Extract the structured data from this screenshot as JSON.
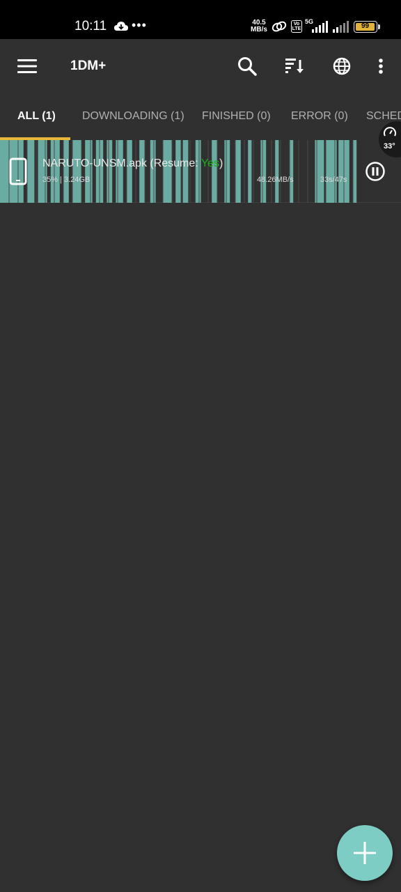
{
  "status_bar": {
    "time": "10:11",
    "net_speed_value": "40.5",
    "net_speed_unit": "MB/s",
    "volte_label": "Vo LTE",
    "network_type": "5G",
    "battery": "99"
  },
  "app_bar": {
    "title": "1DM+",
    "icons": [
      "menu-icon",
      "search-icon",
      "sort-icon",
      "globe-icon",
      "more-vert-icon"
    ]
  },
  "tabs": [
    {
      "label": "ALL (1)",
      "active": true
    },
    {
      "label": "DOWNLOADING (1)",
      "active": false
    },
    {
      "label": "FINISHED (0)",
      "active": false
    },
    {
      "label": "ERROR (0)",
      "active": false
    },
    {
      "label": "SCHED",
      "active": false
    }
  ],
  "temperature": "33°",
  "download": {
    "file_name": "NARUTO-UNSM.apk (Resume: ",
    "resume_value": "Yes",
    "file_name_close": ")",
    "progress_text": "35% | 3.24GB",
    "speed": "48.26MB/s",
    "eta": "33s/47s",
    "progress": 0.35,
    "chunks_completed_fraction": [
      [
        0.0,
        0.065
      ],
      [
        0.075,
        0.095
      ],
      [
        0.105,
        0.13
      ],
      [
        0.14,
        0.165
      ],
      [
        0.175,
        0.19
      ],
      [
        0.2,
        0.225
      ],
      [
        0.235,
        0.255
      ],
      [
        0.265,
        0.285
      ],
      [
        0.295,
        0.31
      ],
      [
        0.32,
        0.34
      ],
      [
        0.35,
        0.365
      ],
      [
        0.385,
        0.4
      ],
      [
        0.415,
        0.43
      ],
      [
        0.45,
        0.475
      ],
      [
        0.485,
        0.5
      ],
      [
        0.505,
        0.52
      ],
      [
        0.54,
        0.555
      ],
      [
        0.585,
        0.6
      ],
      [
        0.62,
        0.635
      ],
      [
        0.65,
        0.665
      ],
      [
        0.685,
        0.695
      ],
      [
        0.72,
        0.735
      ],
      [
        0.76,
        0.77
      ],
      [
        0.8,
        0.81
      ],
      [
        0.87,
        0.895
      ],
      [
        0.9,
        0.93
      ],
      [
        0.935,
        0.965
      ],
      [
        0.975,
        0.985
      ]
    ],
    "colors": {
      "chunk": "#6aaba2",
      "chunk_divider": "#2e3e3c",
      "resume_yes": "#17b317"
    }
  },
  "fab": {
    "icon": "plus-icon",
    "color": "#7ecdc4"
  },
  "colors": {
    "background": "#303030",
    "tab_indicator": "#e8b83a",
    "status_bar": "#000000"
  }
}
